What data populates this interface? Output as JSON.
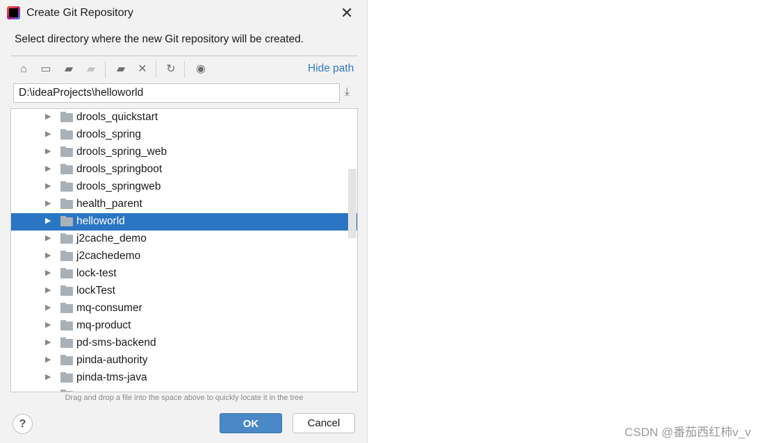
{
  "dialog": {
    "title": "Create Git Repository",
    "message": "Select directory where the new Git repository will be created.",
    "hide_path": "Hide path",
    "path": "D:\\ideaProjects\\helloworld",
    "hint": "Drag and drop a file into the space above to quickly locate it in the tree",
    "help": "?",
    "ok": "OK",
    "cancel": "Cancel"
  },
  "toolbar": [
    "home-icon",
    "desktop-icon",
    "project-folder-icon",
    "module-folder-icon",
    "new-folder-icon",
    "delete-icon",
    "refresh-icon",
    "show-hidden-icon"
  ],
  "tree": {
    "selected": "helloworld",
    "items": [
      "drools_quickstart",
      "drools_spring",
      "drools_spring_web",
      "drools_springboot",
      "drools_springweb",
      "health_parent",
      "helloworld",
      "j2cache_demo",
      "j2cachedemo",
      "lock-test",
      "lockTest",
      "mq-consumer",
      "mq-product",
      "pd-sms-backend",
      "pinda-authority",
      "pinda-tms-java"
    ]
  },
  "watermark": "CSDN @番茄西红柿v_v",
  "colors": {
    "selection": "#2a75c4",
    "link": "#2f7bc6",
    "ok_button": "#4a88c7"
  }
}
